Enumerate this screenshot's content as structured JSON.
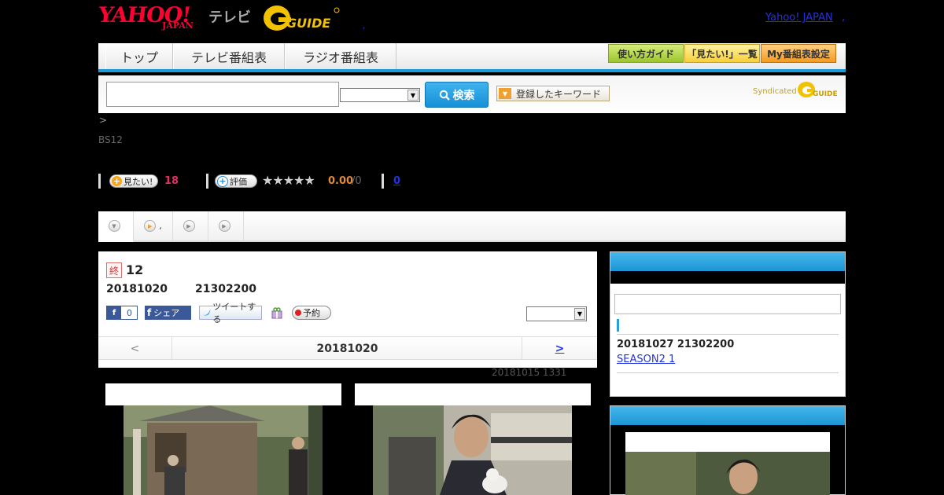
{
  "header": {
    "logo_yahoo": "YAHOO!",
    "logo_japan": "JAPAN",
    "logo_tv": "テレビ",
    "logo_gguide": "GUIDE",
    "dot": ",",
    "yahoo_japan_link": "Yahoo! JAPAN",
    "yahoo_japan_sep": ","
  },
  "nav": {
    "tabs": [
      "トップ",
      "テレビ番組表",
      "ラジオ番組表"
    ],
    "right_buttons": [
      "使い方ガイド",
      "「見たい!」一覧",
      "My番組表設定"
    ]
  },
  "search": {
    "input_value": "",
    "select_value": "",
    "button_label": "検索",
    "keyword_button": "登録したキーワード",
    "syndicated": "Syndicated",
    "syndicated_brand": "GUIDE"
  },
  "breadcrumb": ">",
  "channel": "BS12",
  "actions": {
    "want_label": "見たい!",
    "want_count": "18",
    "rate_label": "評価",
    "stars": "★★★★★",
    "score": "0.00",
    "score_denominator": "/0",
    "review_count": "0"
  },
  "subtabs": [
    "",
    ",",
    "",
    ""
  ],
  "program": {
    "badge": "終",
    "title": "12",
    "date": "20181020",
    "time": "21302200",
    "fb_like_count": "0",
    "fb_share": "シェア",
    "tweet": "ツイートする",
    "reserve": "予約",
    "select_value": "",
    "pager_prev": "<",
    "pager_current": "20181020",
    "pager_next": ">",
    "updated": "20181015  1331"
  },
  "sidebar": {
    "next_date": "20181027  21302200",
    "next_link": "SEASON2 1"
  },
  "colors": {
    "accent": "#1a9ad6",
    "want_count": "#e03060",
    "score": "#e08a3a",
    "link": "#2233dd"
  }
}
